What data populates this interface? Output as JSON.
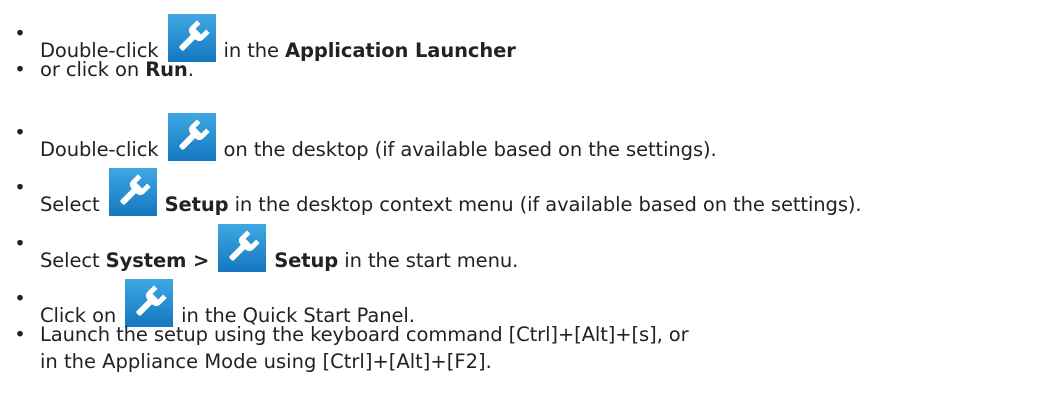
{
  "icon": {
    "name": "wrench-icon",
    "bg_top": "#3fa8e3",
    "bg_bottom": "#1477bf",
    "fg": "#ffffff"
  },
  "items": [
    {
      "pre": "Double-click",
      "post": "in the",
      "bold": "Application Launcher"
    },
    {
      "pre": "or click on",
      "bold": "Run",
      "post": "."
    },
    {
      "pre": "Double-click",
      "post": "on the desktop (if available based on the settings)."
    },
    {
      "pre": "Select",
      "bold": "Setup",
      "post": "in the desktop context menu (if available based on the settings)."
    },
    {
      "pre": "Select",
      "bold1": "System >",
      "bold2": "Setup",
      "post": "in the start menu."
    },
    {
      "pre": "Click on",
      "post": "in the Quick Start Panel."
    },
    {
      "line1": "Launch the setup using the keyboard command [Ctrl]+[Alt]+[s], or",
      "line2": "in the Appliance Mode using [Ctrl]+[Alt]+[F2]."
    }
  ]
}
